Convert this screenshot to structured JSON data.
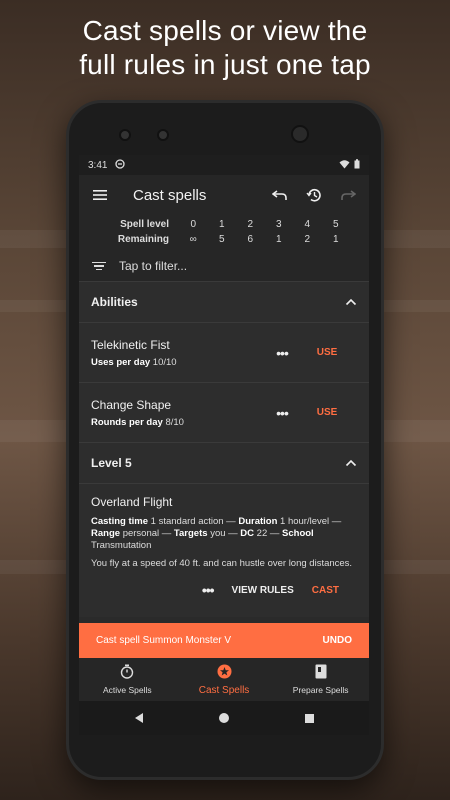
{
  "headline": [
    "Cast spells or view the",
    "full rules in just one tap"
  ],
  "status": {
    "time": "3:41"
  },
  "appbar": {
    "title": "Cast spells"
  },
  "spell_table": {
    "level_label": "Spell level",
    "remaining_label": "Remaining",
    "levels": [
      "0",
      "1",
      "2",
      "3",
      "4",
      "5"
    ],
    "remaining": [
      "∞",
      "5",
      "6",
      "1",
      "2",
      "1"
    ]
  },
  "filter": {
    "placeholder": "Tap to filter..."
  },
  "abilities": {
    "title": "Abilities",
    "items": [
      {
        "name": "Telekinetic Fist",
        "stat_label": "Uses per day",
        "stat_value": "10/10",
        "action": "USE"
      },
      {
        "name": "Change Shape",
        "stat_label": "Rounds per day",
        "stat_value": "8/10",
        "action": "USE"
      }
    ]
  },
  "level5": {
    "title": "Level 5",
    "spell": {
      "name": "Overland Flight",
      "casting_time_label": "Casting time",
      "casting_time": "1 standard action —",
      "duration_label": "Duration",
      "duration": "1 hour/level —",
      "range_label": "Range",
      "range": "personal —",
      "targets_label": "Targets",
      "targets": "you —",
      "dc_label": "DC",
      "dc": "22 —",
      "school_label": "School",
      "school": "Transmutation",
      "description": "You fly at a speed of 40 ft. and can hustle over long distances.",
      "view_rules": "VIEW RULES",
      "cast": "CAST"
    }
  },
  "snackbar": {
    "message": "Cast spell Summon Monster V",
    "action": "UNDO"
  },
  "bottom_nav": [
    {
      "label": "Active Spells",
      "icon": "timer-icon"
    },
    {
      "label": "Cast Spells",
      "icon": "star-badge-icon"
    },
    {
      "label": "Prepare Spells",
      "icon": "book-icon"
    }
  ],
  "colors": {
    "accent": "#ff6e42",
    "surface": "#2d2d2d",
    "appbar": "#262626"
  }
}
